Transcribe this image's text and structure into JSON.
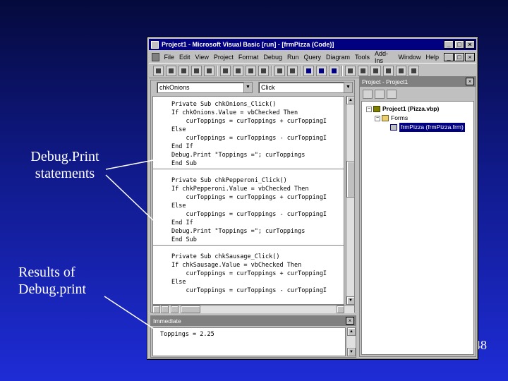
{
  "slide": {
    "label_debug_print": "Debug.Print statements",
    "label_results": "Results of Debug.print",
    "page_number": "48"
  },
  "window": {
    "title": "Project1 - Microsoft Visual Basic [run] - [frmPizza (Code)]",
    "menu": [
      "File",
      "Edit",
      "View",
      "Project",
      "Format",
      "Debug",
      "Run",
      "Query",
      "Diagram",
      "Tools",
      "Add-Ins",
      "Window",
      "Help"
    ]
  },
  "code_window": {
    "object_combo": "chkOnions",
    "procedure_combo": "Click",
    "blocks": [
      [
        "Private Sub chkOnions_Click()",
        "If chkOnions.Value = vbChecked Then",
        "    curToppings = curToppings + curToppingI",
        "Else",
        "    curToppings = curToppings - curToppingI",
        "End If",
        "Debug.Print \"Toppings =\"; curToppings",
        "End Sub"
      ],
      [
        "Private Sub chkPepperoni_Click()",
        "If chkPepperoni.Value = vbChecked Then",
        "    curToppings = curToppings + curToppingI",
        "Else",
        "    curToppings = curToppings - curToppingI",
        "End If",
        "Debug.Print \"Toppings =\"; curToppings",
        "End Sub"
      ],
      [
        "Private Sub chkSausage_Click()",
        "If chkSausage.Value = vbChecked Then",
        "    curToppings = curToppings + curToppingI",
        "Else",
        "    curToppings = curToppings - curToppingI"
      ]
    ]
  },
  "project_explorer": {
    "title": "Project - Project1",
    "tree": {
      "project": "Project1 (Pizza.vbp)",
      "folder": "Forms",
      "form": "frmPizza (frmPizza.frm)"
    }
  },
  "immediate_window": {
    "title": "Immediate",
    "output": "Toppings = 2.25"
  },
  "colors": {
    "title_active": "#000080",
    "title_inactive": "#808080",
    "chrome": "#c0c0c0",
    "slide_text": "#ffffff"
  }
}
